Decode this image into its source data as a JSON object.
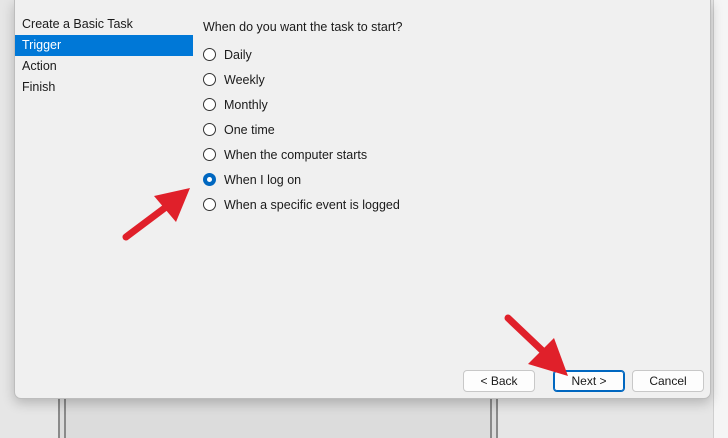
{
  "wizard": {
    "steps": [
      {
        "label": "Create a Basic Task"
      },
      {
        "label": "Trigger"
      },
      {
        "label": "Action"
      },
      {
        "label": "Finish"
      }
    ],
    "active_step": 1
  },
  "trigger": {
    "question": "When do you want the task to start?",
    "options": [
      {
        "label": "Daily",
        "checked": false
      },
      {
        "label": "Weekly",
        "checked": false
      },
      {
        "label": "Monthly",
        "checked": false
      },
      {
        "label": "One time",
        "checked": false
      },
      {
        "label": "When the computer starts",
        "checked": false
      },
      {
        "label": "When I log on",
        "checked": true
      },
      {
        "label": "When a specific event is logged",
        "checked": false
      }
    ]
  },
  "buttons": {
    "back_label": "< Back",
    "next_label": "Next >",
    "cancel_label": "Cancel"
  },
  "colors": {
    "accent": "#0078d7",
    "annotation_arrow": "#e0202a"
  }
}
